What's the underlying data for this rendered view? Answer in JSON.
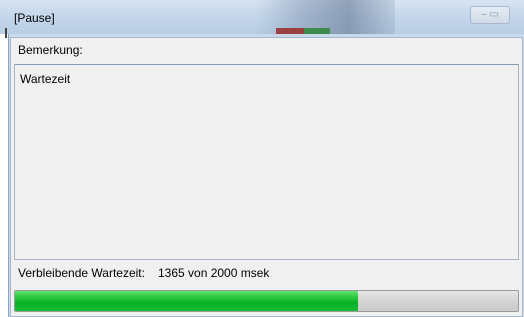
{
  "window": {
    "title": "[Pause]"
  },
  "remark": {
    "label": "Bemerkung:",
    "text": "Wartezeit"
  },
  "status": {
    "remaining_label": "Verbleibende Wartezeit:",
    "remaining_value": "1365 von 2000 msek"
  },
  "progress": {
    "value": 0.6825,
    "color": "#06b025"
  }
}
